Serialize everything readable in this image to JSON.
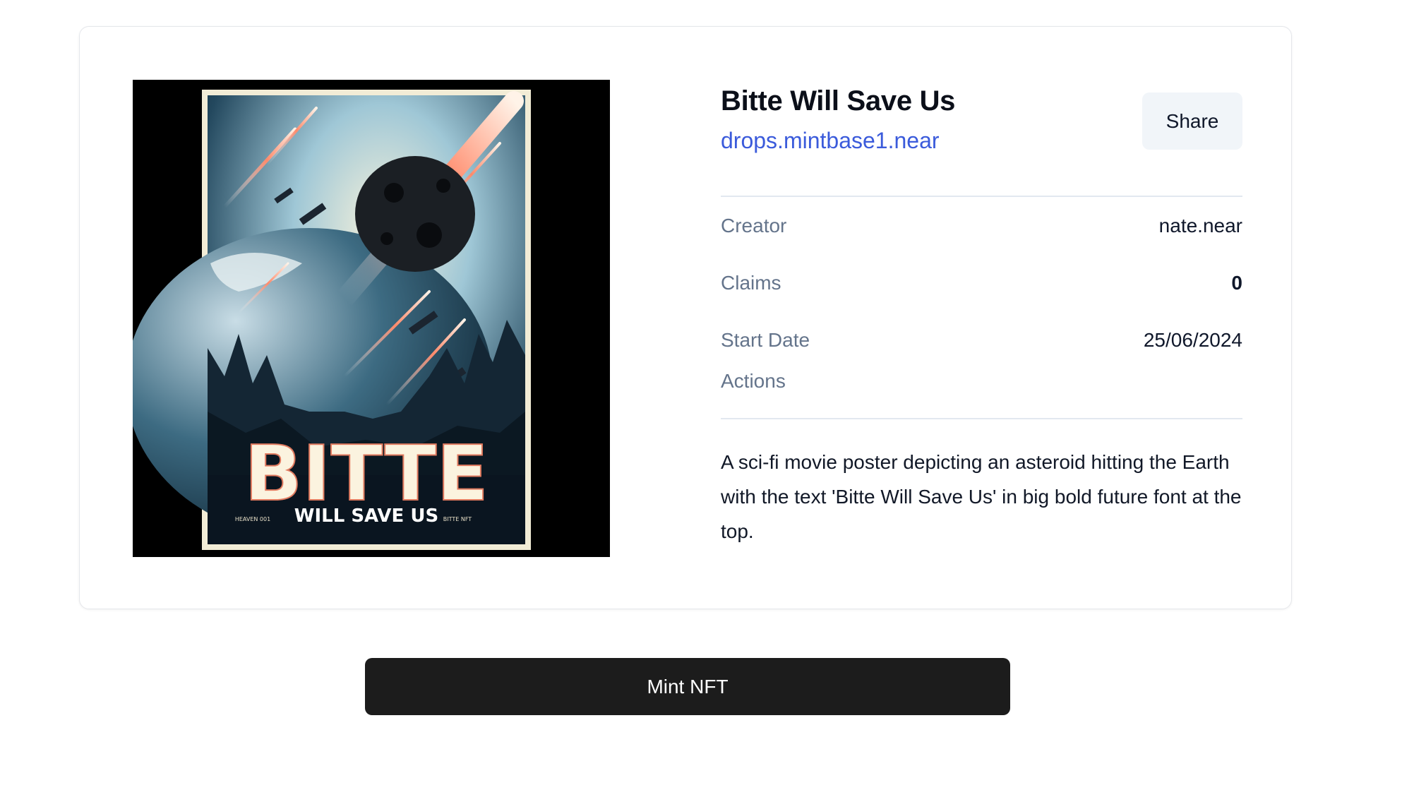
{
  "nft": {
    "title": "Bitte Will Save Us",
    "contract": "drops.mintbase1.near",
    "share_label": "Share",
    "details": {
      "creator_label": "Creator",
      "creator_value": "nate.near",
      "claims_label": "Claims",
      "claims_value": "0",
      "start_date_label": "Start Date",
      "start_date_value": "25/06/2024",
      "actions_label": "Actions"
    },
    "description": "A sci-fi movie poster depicting an asteroid hitting the Earth with the text 'Bitte Will Save Us' in big bold future font at the top.",
    "image": {
      "headline": "BITTE",
      "subline": "WILL SAVE US",
      "small_left": "HEAVEN 001",
      "small_right": "BITTE NFT"
    }
  },
  "mint_label": "Mint NFT",
  "colors": {
    "link": "#3b5bdb",
    "mint_button": "#1c1c1c",
    "share_button": "#f1f5f9"
  }
}
